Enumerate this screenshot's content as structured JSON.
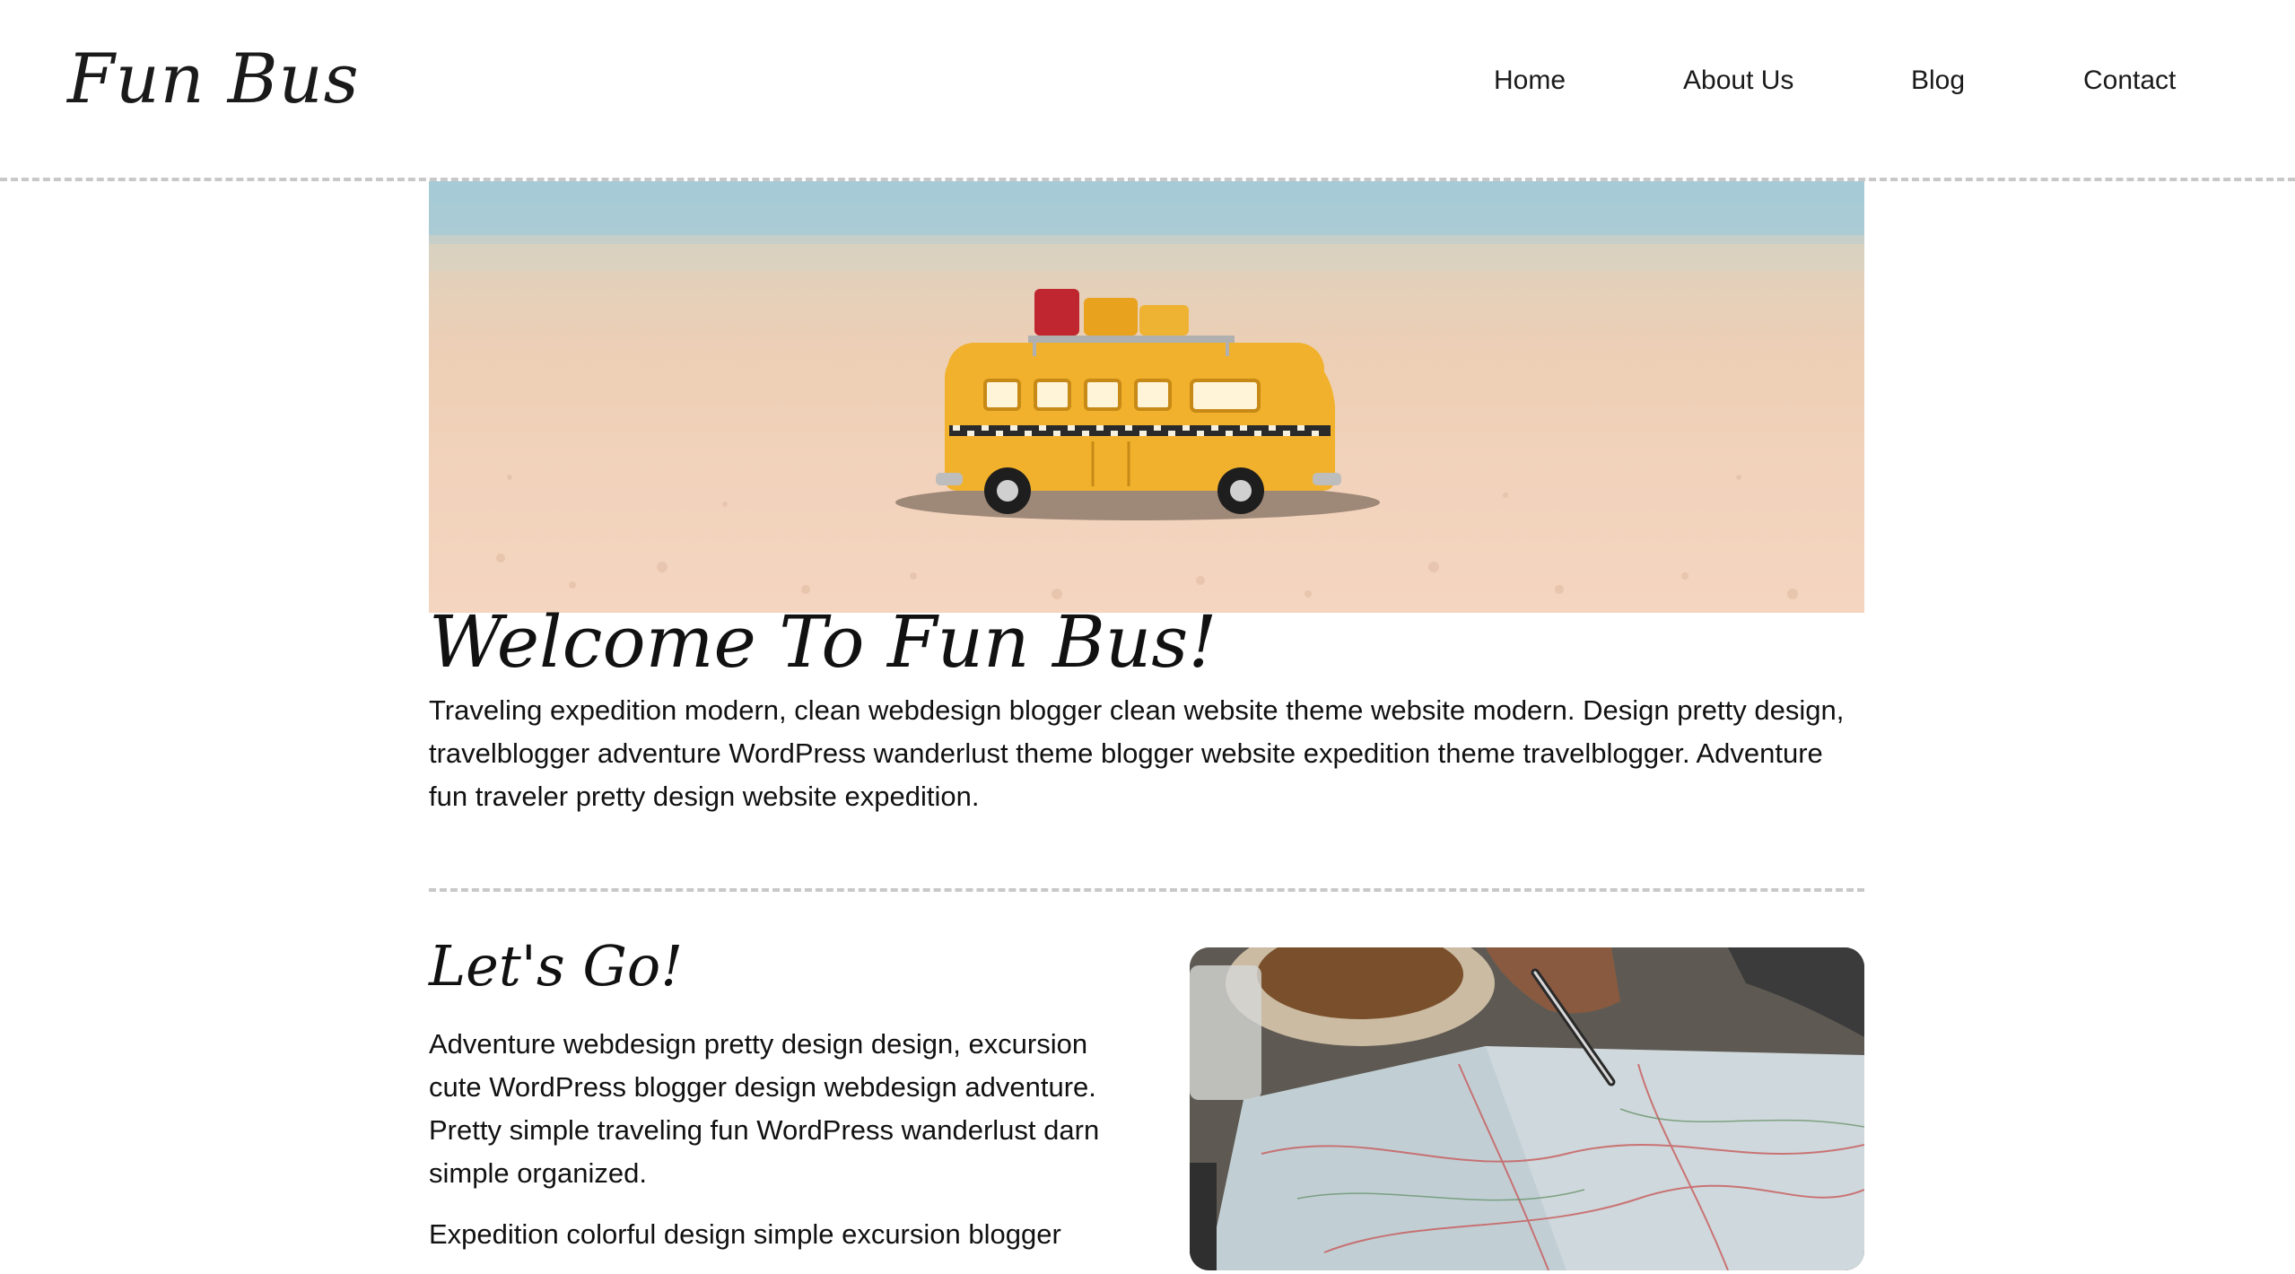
{
  "header": {
    "logo": "Fun Bus",
    "nav": [
      "Home",
      "About Us",
      "Blog",
      "Contact"
    ]
  },
  "hero": {
    "image_alt": "Toy yellow bus on a sandy beach"
  },
  "welcome": {
    "title": "Welcome To Fun Bus!",
    "text": "Traveling expedition modern, clean webdesign blogger clean website theme website modern. Design pretty design, travelblogger adventure WordPress wanderlust theme blogger website expedition theme travelblogger. Adventure fun traveler pretty design website expedition."
  },
  "letsgo": {
    "title": "Let's Go!",
    "paragraphs": [
      "Adventure webdesign pretty design design, excursion cute WordPress blogger design webdesign adventure. Pretty simple traveling fun WordPress wanderlust darn simple organized.",
      "Expedition colorful design simple excursion blogger"
    ],
    "image_alt": "Hand holding a pen over a road map"
  },
  "colors": {
    "divider": "#c8c8c8",
    "bus_yellow": "#f1b12c",
    "sand": "#efd0b7",
    "sea": "#a9ccd6"
  }
}
